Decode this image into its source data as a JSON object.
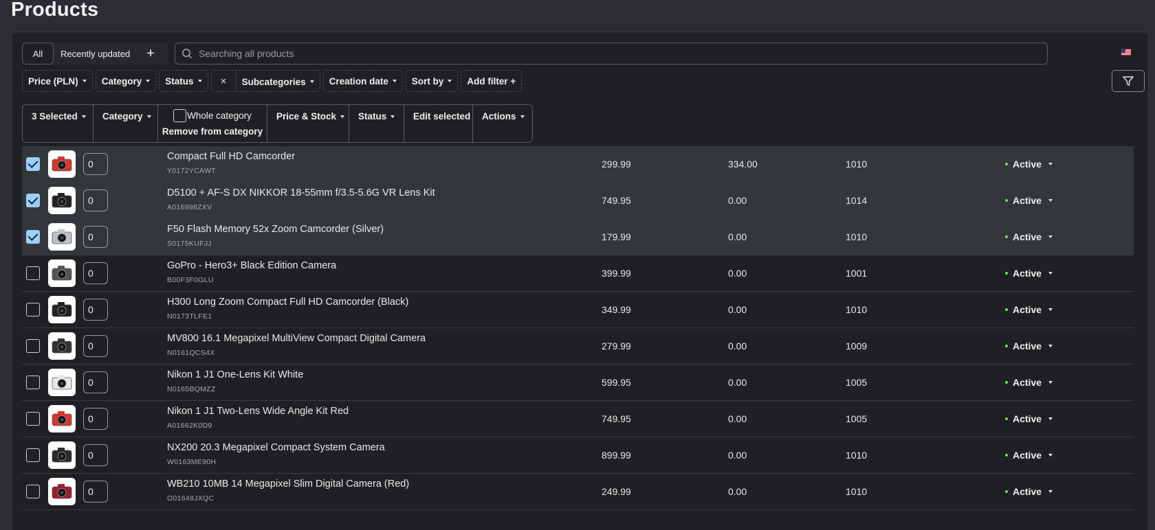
{
  "page": {
    "title": "Products"
  },
  "tabs": {
    "all": "All",
    "recent": "Recently updated",
    "add": "+"
  },
  "search": {
    "placeholder": "Searching all products"
  },
  "filters": [
    "Price (PLN)",
    "Category",
    "Status",
    "Subcategories",
    "Creation date",
    "Sort by"
  ],
  "filters_clear": "×",
  "add_filter": "Add filter +",
  "bulk": {
    "selected": "3 Selected",
    "category": "Category",
    "whole_category": "Whole category",
    "remove_from_category": "Remove from category",
    "price_stock": "Price & Stock",
    "status": "Status",
    "edit_selected": "Edit selected",
    "actions": "Actions"
  },
  "colors": {
    "accent_check": "#9ccfff",
    "status_dot": "#7ddc6a"
  },
  "products": [
    {
      "name": "Compact Full HD Camcorder",
      "sku": "Y0172YCAWT",
      "qty": "0",
      "price": "299.99",
      "price2": "334.00",
      "code": "1010",
      "status": "Active",
      "selected": true,
      "icon": "red-camcorder-icon"
    },
    {
      "name": "D5100 + AF-S DX NIKKOR 18-55mm f/3.5-5.6G VR Lens Kit",
      "sku": "A016998ZXV",
      "qty": "0",
      "price": "749.95",
      "price2": "0.00",
      "code": "1014",
      "status": "Active",
      "selected": true,
      "icon": "dslr-camera-icon"
    },
    {
      "name": "F50 Flash Memory 52x Zoom Camcorder (Silver)",
      "sku": "S0175KUFJJ",
      "qty": "0",
      "price": "179.99",
      "price2": "0.00",
      "code": "1010",
      "status": "Active",
      "selected": true,
      "icon": "silver-camcorder-icon"
    },
    {
      "name": "GoPro - Hero3+ Black Edition Camera",
      "sku": "B00F3F0GLU",
      "qty": "0",
      "price": "399.99",
      "price2": "0.00",
      "code": "1001",
      "status": "Active",
      "selected": false,
      "icon": "action-camera-icon"
    },
    {
      "name": "H300 Long Zoom Compact Full HD Camcorder (Black)",
      "sku": "N0173TLFE1",
      "qty": "0",
      "price": "349.99",
      "price2": "0.00",
      "code": "1010",
      "status": "Active",
      "selected": false,
      "icon": "black-camcorder-icon"
    },
    {
      "name": "MV800 16.1 Megapixel MultiView Compact Digital Camera",
      "sku": "N0161QCS4X",
      "qty": "0",
      "price": "279.99",
      "price2": "0.00",
      "code": "1009",
      "status": "Active",
      "selected": false,
      "icon": "compact-camera-icon"
    },
    {
      "name": "Nikon 1 J1 One-Lens Kit White",
      "sku": "N0165BQMZZ",
      "qty": "0",
      "price": "599.95",
      "price2": "0.00",
      "code": "1005",
      "status": "Active",
      "selected": false,
      "icon": "white-camera-icon"
    },
    {
      "name": "Nikon 1 J1 Two-Lens Wide Angle Kit Red",
      "sku": "A01662K0D9",
      "qty": "0",
      "price": "749.95",
      "price2": "0.00",
      "code": "1005",
      "status": "Active",
      "selected": false,
      "icon": "red-camera-icon"
    },
    {
      "name": "NX200 20.3 Megapixel Compact System Camera",
      "sku": "W0163ME90H",
      "qty": "0",
      "price": "899.99",
      "price2": "0.00",
      "code": "1010",
      "status": "Active",
      "selected": false,
      "icon": "system-camera-icon"
    },
    {
      "name": "WB210 10MB 14 Megapixel Slim Digital Camera (Red)",
      "sku": "O01648JXQC",
      "qty": "0",
      "price": "249.99",
      "price2": "0.00",
      "code": "1010",
      "status": "Active",
      "selected": false,
      "icon": "slim-red-camera-icon"
    }
  ]
}
